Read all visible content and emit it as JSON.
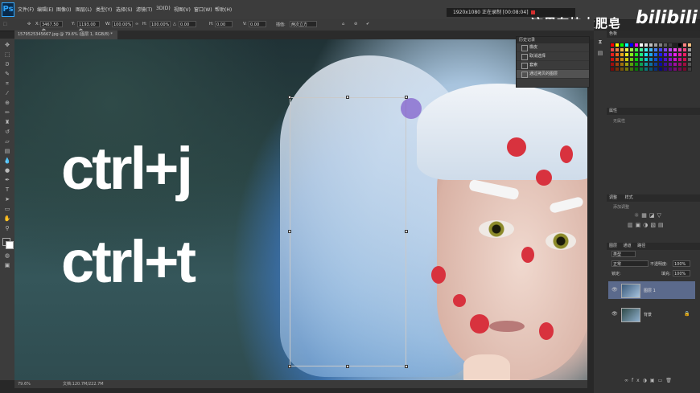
{
  "menu": {
    "logo": "Ps",
    "items": [
      "文件(F)",
      "编辑(E)",
      "图像(I)",
      "图层(L)",
      "类型(Y)",
      "选择(S)",
      "滤镜(T)",
      "3D(D)",
      "视图(V)",
      "窗口(W)",
      "帮助(H)"
    ]
  },
  "recording": {
    "text": "1920x1080  正在录制 [00:08:04]"
  },
  "watermark": {
    "text": "这里有块大肥皂",
    "brand": "bilibili"
  },
  "options": {
    "x_label": "X:",
    "x_value": "3467.50 像",
    "y_label": "Y:",
    "y_value": "1193.00 像",
    "w_label": "W:",
    "w_value": "100.00%",
    "h_label": "H:",
    "h_value": "100.00%",
    "angle_value": "0.00",
    "hskew_label": "H:",
    "hskew_value": "0.00",
    "vskew_label": "V:",
    "vskew_value": "0.00",
    "interp_label": "插值:",
    "interp_value": "两次立方"
  },
  "document": {
    "tab": "1579525345667.jpg @ 79.6% (图层 1, RGB/8) *"
  },
  "canvas": {
    "line1": "ctrl+j",
    "line2": "ctrl+t"
  },
  "status": {
    "zoom": "79.6%",
    "doc": "文档:120.7M/222.7M"
  },
  "history": {
    "title": "历史记录",
    "items": [
      {
        "label": "橡皮"
      },
      {
        "label": "取消选择"
      },
      {
        "label": "套索"
      },
      {
        "label": "通过拷贝的图层",
        "selected": true
      }
    ]
  },
  "panels": {
    "swatches_tab": "色板",
    "properties_tab": "属性",
    "properties_empty": "无属性",
    "adjust_tab": "调整",
    "styles_tab": "样式",
    "adjust_hint": "添加调整",
    "layers_tab": "图层",
    "channels_tab": "通道",
    "paths_tab": "路径",
    "kind": "类型",
    "blend": "正常",
    "opacity_label": "不透明度:",
    "opacity": "100%",
    "lock_label": "锁定:",
    "fill_label": "填充:",
    "fill": "100%",
    "layers": [
      {
        "name": "图层 1",
        "selected": true
      },
      {
        "name": "背景",
        "selected": false
      }
    ]
  },
  "swatch_colors": [
    "#ff0000",
    "#ffff00",
    "#00ff00",
    "#00ffff",
    "#0000ff",
    "#ff00ff",
    "#ffffff",
    "#e0e0e0",
    "#c0c0c0",
    "#a0a0a0",
    "#808080",
    "#606060",
    "#404040",
    "#202020",
    "#000000",
    "#ff8080",
    "#ffc080"
  ]
}
